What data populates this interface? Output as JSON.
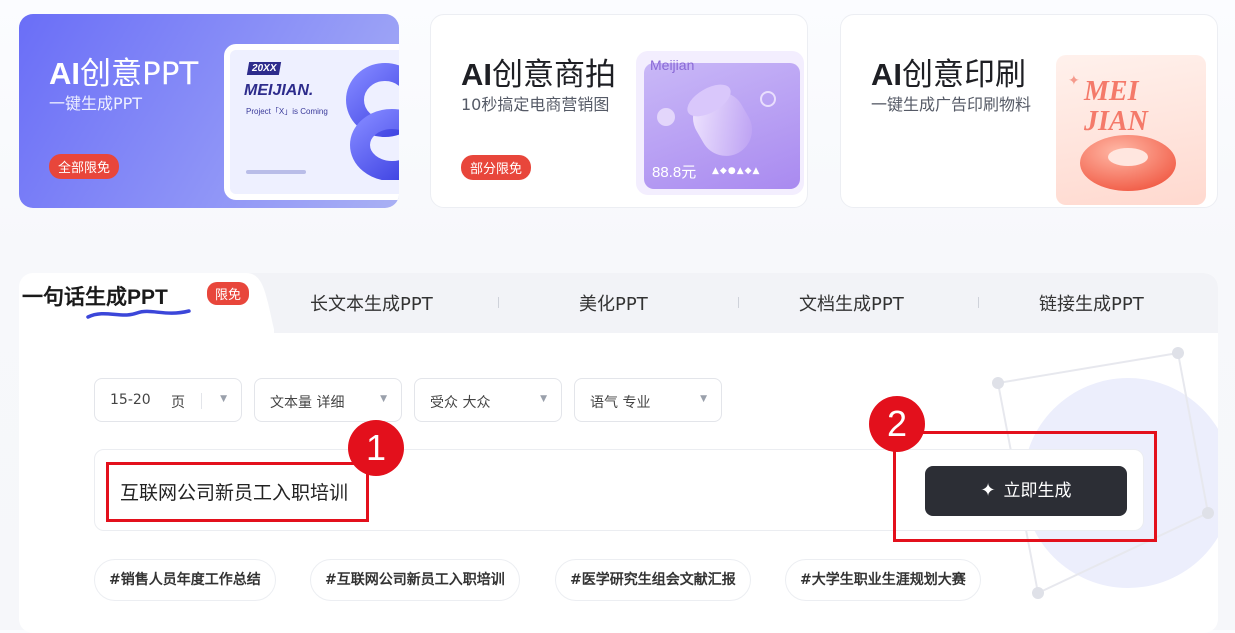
{
  "cards": [
    {
      "title_ai": "AI",
      "title_rest": "创意PPT",
      "subtitle": "一键生成PPT",
      "badge": "全部限免",
      "art": {
        "tag": "20XX",
        "brand": "MEIJIAN.",
        "tagline": "Project「X」is Coming"
      }
    },
    {
      "title_ai": "AI",
      "title_rest": "创意商拍",
      "subtitle": "10秒搞定电商营销图",
      "badge": "部分限免",
      "art": {
        "brand": "Meijian",
        "price": "88.8元",
        "shapes": "▲◆●▲◆▲"
      }
    },
    {
      "title_ai": "AI",
      "title_rest": "创意印刷",
      "subtitle": "一键生成广告印刷物料",
      "art": {
        "word": "MEI JIAN"
      }
    }
  ],
  "tabs": {
    "active": {
      "label_cn": "一句话生成",
      "label_ppt": "PPT",
      "badge": "限免"
    },
    "items": [
      "长文本生成PPT",
      "美化PPT",
      "文档生成PPT",
      "链接生成PPT"
    ]
  },
  "selectors": [
    {
      "label": "15-20",
      "unit": "页"
    },
    {
      "label": "文本量 详细"
    },
    {
      "label": "受众 大众"
    },
    {
      "label": "语气 专业"
    }
  ],
  "prompt_input": {
    "value": "互联网公司新员工入职培训"
  },
  "generate_button": {
    "label": "立即生成",
    "icon": "sparkle-icon"
  },
  "suggestions": [
    "#销售人员年度工作总结",
    "#互联网公司新员工入职培训",
    "#医学研究生组会文献汇报",
    "#大学生职业生涯规划大赛"
  ],
  "annotations": [
    {
      "number": "1",
      "target": "prompt_input"
    },
    {
      "number": "2",
      "target": "generate_button"
    }
  ],
  "colors": {
    "accent_red": "#e3101c",
    "badge_red": "#e8463b",
    "primary_card": "#6a6ef7",
    "button_dark": "#2c2e35"
  }
}
